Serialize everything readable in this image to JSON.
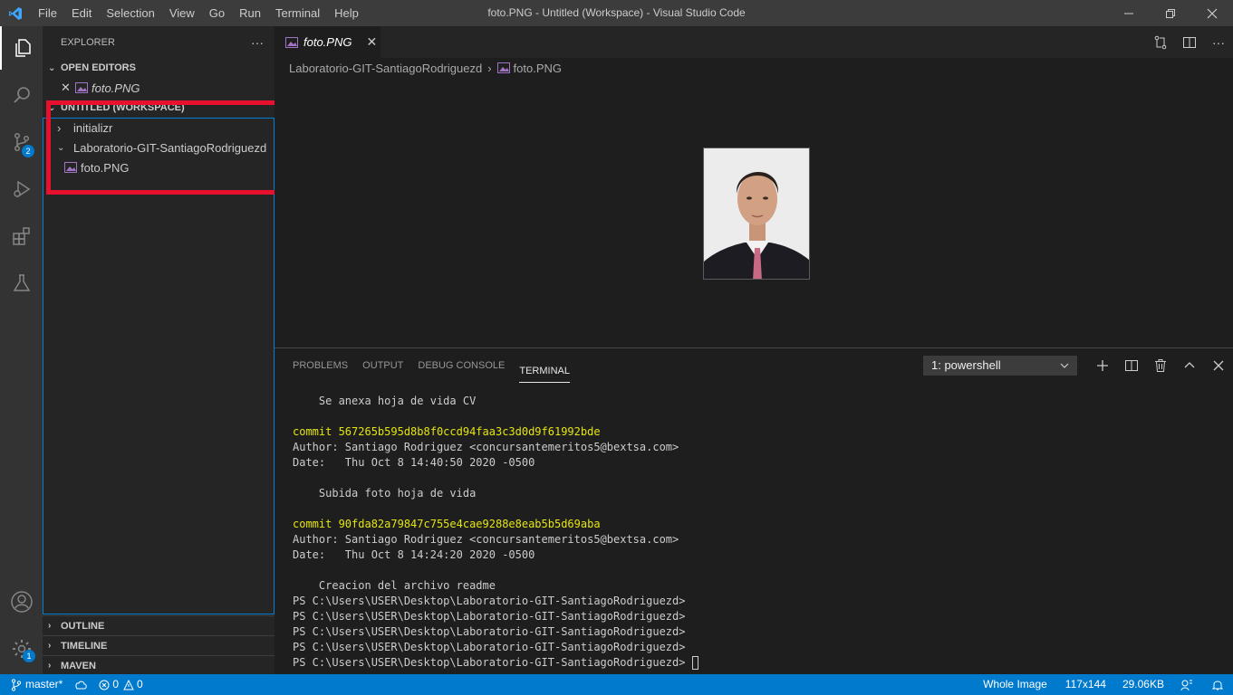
{
  "window": {
    "title": "foto.PNG - Untitled (Workspace) - Visual Studio Code",
    "menu": [
      "File",
      "Edit",
      "Selection",
      "View",
      "Go",
      "Run",
      "Terminal",
      "Help"
    ]
  },
  "activity_bar": {
    "source_control_badge": "2",
    "settings_badge": "1"
  },
  "sidebar": {
    "title": "EXPLORER",
    "more": "···",
    "open_editors_label": "OPEN EDITORS",
    "open_editor_file": "foto.PNG",
    "workspace_label": "UNTITLED (WORKSPACE)",
    "folders": [
      {
        "name": "initializr",
        "expanded": false
      },
      {
        "name": "Laboratorio-GIT-SantiagoRodriguezd",
        "expanded": true
      }
    ],
    "file": "foto.PNG",
    "sections": [
      "OUTLINE",
      "TIMELINE",
      "MAVEN"
    ]
  },
  "editor": {
    "tab_label": "foto.PNG",
    "breadcrumb_folder": "Laboratorio-GIT-SantiagoRodriguezd",
    "breadcrumb_file": "foto.PNG"
  },
  "panel": {
    "tabs": [
      "PROBLEMS",
      "OUTPUT",
      "DEBUG CONSOLE",
      "TERMINAL"
    ],
    "active_tab": "TERMINAL",
    "terminal_select": "1: powershell",
    "lines": [
      {
        "text": "    Se anexa hoja de vida CV",
        "color": "#cccccc"
      },
      {
        "text": "",
        "color": "#cccccc"
      },
      {
        "text": "commit 567265b595d8b8f0ccd94faa3c3d0d9f61992bde",
        "color": "#e5e510"
      },
      {
        "text": "Author: Santiago Rodriguez <concursantemeritos5@bextsa.com>",
        "color": "#cccccc"
      },
      {
        "text": "Date:   Thu Oct 8 14:40:50 2020 -0500",
        "color": "#cccccc"
      },
      {
        "text": "",
        "color": "#cccccc"
      },
      {
        "text": "    Subida foto hoja de vida",
        "color": "#cccccc"
      },
      {
        "text": "",
        "color": "#cccccc"
      },
      {
        "text": "commit 90fda82a79847c755e4cae9288e8eab5b5d69aba",
        "color": "#e5e510"
      },
      {
        "text": "Author: Santiago Rodriguez <concursantemeritos5@bextsa.com>",
        "color": "#cccccc"
      },
      {
        "text": "Date:   Thu Oct 8 14:24:20 2020 -0500",
        "color": "#cccccc"
      },
      {
        "text": "",
        "color": "#cccccc"
      },
      {
        "text": "    Creacion del archivo readme",
        "color": "#cccccc"
      },
      {
        "text": "PS C:\\Users\\USER\\Desktop\\Laboratorio-GIT-SantiagoRodriguezd>",
        "color": "#cccccc"
      },
      {
        "text": "PS C:\\Users\\USER\\Desktop\\Laboratorio-GIT-SantiagoRodriguezd>",
        "color": "#cccccc"
      },
      {
        "text": "PS C:\\Users\\USER\\Desktop\\Laboratorio-GIT-SantiagoRodriguezd>",
        "color": "#cccccc"
      },
      {
        "text": "PS C:\\Users\\USER\\Desktop\\Laboratorio-GIT-SantiagoRodriguezd>",
        "color": "#cccccc"
      }
    ],
    "prompt": "PS C:\\Users\\USER\\Desktop\\Laboratorio-GIT-SantiagoRodriguezd> "
  },
  "statusbar": {
    "branch": "master*",
    "errors": "0",
    "warnings": "0",
    "view_mode": "Whole Image",
    "dimensions": "117x144",
    "file_size": "29.06KB"
  },
  "colors": {
    "accent": "#007acc",
    "highlight_box": "#e8112d",
    "commit_yellow": "#e5e510"
  }
}
